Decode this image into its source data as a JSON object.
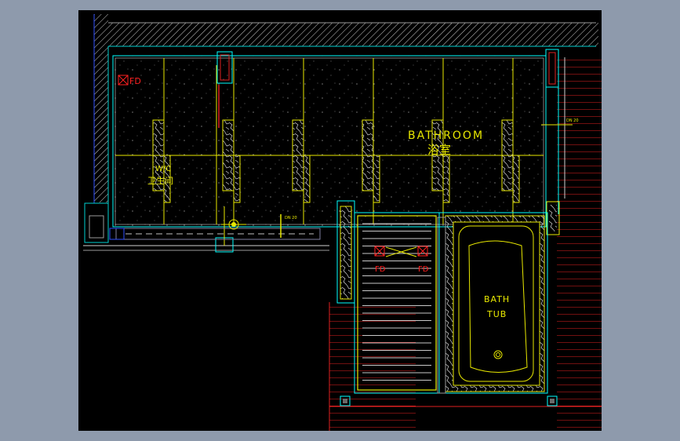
{
  "viewport": {
    "background": "#000000",
    "frame_color": "#8e9aac"
  },
  "colors": {
    "wall_outline": "#00ffff",
    "tile_grid": "#ffff00",
    "tile_fill": "#000000",
    "hatch": "#ffffff",
    "exterior_hatch": "#ff2020",
    "label": "#ffff00",
    "drain_symbol": "#ff2020"
  },
  "rooms": {
    "bathroom": {
      "name_en": "BATHROOM",
      "name_cn": "浴室"
    },
    "wc": {
      "name_en": "W/C",
      "name_cn": "卫生间"
    }
  },
  "fixtures": {
    "bathtub": {
      "line1": "BATH",
      "line2": "TUB"
    },
    "floor_drains": [
      {
        "label": "FD",
        "room": "wc"
      },
      {
        "label": "FD",
        "room": "shower"
      },
      {
        "label": "FD",
        "room": "shower"
      }
    ]
  },
  "dimension_notes": {
    "door_note_1": "DN 20",
    "door_note_2": "DN 20"
  }
}
